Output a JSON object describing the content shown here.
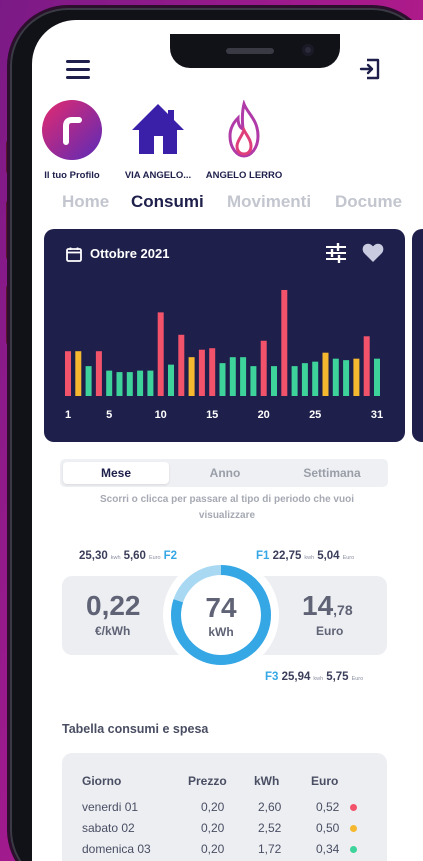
{
  "profiles": [
    {
      "label": "Il tuo Profilo",
      "icon": "profile-logo-icon"
    },
    {
      "label": "VIA ANGELO...",
      "icon": "house-icon"
    },
    {
      "label": "ANGELO LERRO",
      "icon": "flame-icon"
    }
  ],
  "tabs": [
    "Home",
    "Consumi",
    "Movimenti",
    "Docume"
  ],
  "active_tab": "Consumi",
  "chart": {
    "month": "Ottobre 2021",
    "x_ticks": [
      "1",
      "5",
      "10",
      "15",
      "20",
      "25",
      "31"
    ]
  },
  "chart_data": {
    "type": "bar",
    "categories": [
      "1",
      "2",
      "3",
      "4",
      "5",
      "6",
      "7",
      "8",
      "9",
      "10",
      "11",
      "12",
      "13",
      "14",
      "15",
      "16",
      "17",
      "18",
      "19",
      "20",
      "21",
      "22",
      "23",
      "24",
      "25",
      "26",
      "27",
      "28",
      "29",
      "30",
      "31"
    ],
    "values": [
      3.0,
      3.0,
      2.0,
      3.0,
      1.7,
      1.6,
      1.6,
      1.7,
      1.7,
      5.6,
      2.1,
      4.1,
      2.6,
      3.1,
      3.2,
      2.2,
      2.6,
      2.6,
      2.0,
      3.7,
      2.0,
      7.1,
      2.0,
      2.2,
      2.3,
      2.9,
      2.5,
      2.4,
      2.5,
      4.0,
      2.5
    ],
    "bar_colors": [
      "#f2536b",
      "#f5b82e",
      "#3ed39b",
      "#f2536b",
      "#3ed39b",
      "#3ed39b",
      "#3ed39b",
      "#3ed39b",
      "#3ed39b",
      "#f2536b",
      "#3ed39b",
      "#f2536b",
      "#f5b82e",
      "#f2536b",
      "#f2536b",
      "#3ed39b",
      "#3ed39b",
      "#3ed39b",
      "#3ed39b",
      "#f2536b",
      "#3ed39b",
      "#f2536b",
      "#3ed39b",
      "#3ed39b",
      "#3ed39b",
      "#f5b82e",
      "#3ed39b",
      "#3ed39b",
      "#f5b82e",
      "#f2536b",
      "#3ed39b"
    ],
    "title": "",
    "xlabel": "",
    "ylabel": ""
  },
  "period": {
    "options": [
      "Mese",
      "Anno",
      "Settimana"
    ],
    "active": "Mese",
    "hint": "Scorri o clicca per passare al tipo di periodo che vuoi visualizzare"
  },
  "bands": {
    "f2": {
      "kwh": "25,30",
      "kwh_unit": "kwh",
      "euro": "5,60",
      "euro_unit": "Euro",
      "tag": "F2"
    },
    "f1": {
      "kwh": "22,75",
      "kwh_unit": "kwh",
      "euro": "5,04",
      "euro_unit": "Euro",
      "tag": "F1"
    },
    "f3": {
      "kwh": "25,94",
      "kwh_unit": "kwh",
      "euro": "5,75",
      "euro_unit": "Euro",
      "tag": "F3"
    }
  },
  "summary": {
    "price": "0,22",
    "price_unit": "€/kWh",
    "kwh": "74",
    "kwh_unit": "kWh",
    "euro_int": "14",
    "euro_dec": ",78",
    "euro_unit": "Euro",
    "ring_fill": 0.8
  },
  "table": {
    "title": "Tabella consumi e spesa",
    "headers": [
      "Giorno",
      "Prezzo",
      "kWh",
      "Euro"
    ],
    "rows": [
      {
        "day": "venerdi 01",
        "price": "0,20",
        "kwh": "2,60",
        "euro": "0,52",
        "dot": "#f2536b"
      },
      {
        "day": "sabato 02",
        "price": "0,20",
        "kwh": "2,52",
        "euro": "0,50",
        "dot": "#f5b82e"
      },
      {
        "day": "domenica 03",
        "price": "0,20",
        "kwh": "1,72",
        "euro": "0,34",
        "dot": "#3ed39b"
      }
    ]
  },
  "colors": {
    "navy": "#1e1f4b",
    "accent_blue": "#35a7e5",
    "red": "#f2536b",
    "yellow": "#f5b82e",
    "green": "#3ed39b"
  }
}
